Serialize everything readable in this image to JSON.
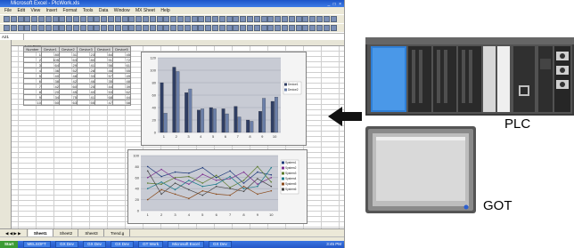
{
  "excel": {
    "title": "Microsoft Excel - PlcWork.xls",
    "menu": [
      "File",
      "Edit",
      "View",
      "Insert",
      "Format",
      "Tools",
      "Data",
      "Window",
      "MX Sheet",
      "Help"
    ],
    "name_box": "A21",
    "sheet_title": "Log Data",
    "table_headers": [
      "Number",
      "Device1",
      "Device2",
      "Device3",
      "Device4",
      "Device5"
    ],
    "table_rows": [
      [
        "1",
        "80",
        "31",
        "23",
        "84",
        "45"
      ],
      [
        "2",
        "105",
        "63",
        "80",
        "91",
        "72"
      ],
      [
        "3",
        "64",
        "29",
        "41",
        "56",
        "61"
      ],
      [
        "4",
        "36",
        "52",
        "28",
        "46",
        "55"
      ],
      [
        "5",
        "40",
        "48",
        "33",
        "57",
        "49"
      ],
      [
        "6",
        "38",
        "42",
        "46",
        "35",
        "48"
      ],
      [
        "7",
        "42",
        "60",
        "25",
        "44",
        "39"
      ],
      [
        "8",
        "20",
        "45",
        "40",
        "53",
        "62"
      ],
      [
        "9",
        "34",
        "75",
        "41",
        "68",
        "44"
      ],
      [
        "10",
        "50",
        "63",
        "55",
        "47",
        "58"
      ]
    ],
    "sheet_tabs": [
      "Sheet1",
      "Sheet2",
      "Sheet3",
      "Trend.g"
    ],
    "taskbar": {
      "start": "Start",
      "tasks": [
        "MELSOFT",
        "GX Dev",
        "GX Dev",
        "GX Dev",
        "GT Work",
        "Microsoft Excel",
        "GX Dev"
      ],
      "clock": "3:45 PM"
    }
  },
  "chart_data": [
    {
      "type": "bar",
      "categories": [
        "1",
        "2",
        "3",
        "4",
        "5",
        "6",
        "7",
        "8",
        "9",
        "10"
      ],
      "series": [
        {
          "name": "Device1",
          "values": [
            80,
            105,
            64,
            36,
            40,
            38,
            42,
            20,
            34,
            50
          ]
        },
        {
          "name": "Device2",
          "values": [
            31,
            98,
            70,
            38,
            38,
            30,
            25,
            18,
            55,
            57
          ]
        }
      ],
      "ylim": [
        0,
        120
      ],
      "yticks": [
        "0",
        "20",
        "40",
        "60",
        "80",
        "100",
        "120"
      ],
      "legend": "right",
      "colors": [
        "#2f3e63",
        "#6b7fa8"
      ],
      "grid": true
    },
    {
      "type": "line",
      "categories": [
        "1",
        "2",
        "3",
        "4",
        "5",
        "6",
        "7",
        "8",
        "9",
        "10"
      ],
      "series": [
        {
          "name": "System1",
          "values": [
            80,
            62,
            70,
            68,
            78,
            60,
            72,
            50,
            70,
            65
          ]
        },
        {
          "name": "System2",
          "values": [
            60,
            75,
            58,
            48,
            66,
            55,
            58,
            70,
            48,
            60
          ]
        },
        {
          "name": "System3",
          "values": [
            50,
            48,
            60,
            62,
            50,
            64,
            42,
            55,
            80,
            52
          ]
        },
        {
          "name": "System4",
          "values": [
            40,
            52,
            38,
            55,
            44,
            48,
            62,
            40,
            44,
            78
          ]
        },
        {
          "name": "System5",
          "values": [
            20,
            38,
            30,
            22,
            36,
            30,
            28,
            44,
            30,
            36
          ]
        },
        {
          "name": "System6",
          "values": [
            72,
            30,
            50,
            38,
            28,
            44,
            40,
            35,
            58,
            44
          ]
        }
      ],
      "ylim": [
        0,
        100
      ],
      "yticks": [
        "0",
        "20",
        "40",
        "60",
        "80",
        "100"
      ],
      "legend": "right",
      "colors": [
        "#1f3a7a",
        "#7b2c8e",
        "#5a7a2a",
        "#1b7b8a",
        "#8a4a1a",
        "#444444"
      ],
      "grid": true
    }
  ],
  "labels": {
    "plc": "PLC",
    "got": "GOT"
  }
}
